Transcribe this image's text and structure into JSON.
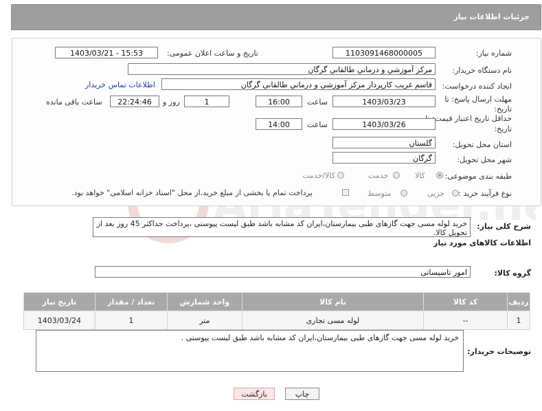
{
  "header": {
    "title": "جزئیات اطلاعات نیاز"
  },
  "form": {
    "need_number": {
      "label": "شماره نیاز:",
      "value": "1103091468000005"
    },
    "announce_datetime": {
      "label": "تاریخ و ساعت اعلان عمومی:",
      "value": "1403/03/21 - 15:53"
    },
    "buyer_org": {
      "label": "نام دستگاه خریدار:",
      "value": "مرکز آموزشي و درماني طالقاني گرگان"
    },
    "requester": {
      "label": "ایجاد کننده درخواست:",
      "value": "قاسم غريب كارپرداز مرکز آموزشي و درماني طالقاني گرگان",
      "contact_link": "اطلاعات تماس خریدار"
    },
    "reply_deadline": {
      "label_line1": "مهلت ارسال پاسخ: تا",
      "label_line2": "تاریخ:",
      "date": "1403/03/23",
      "time_label": "ساعت",
      "time": "16:00",
      "days": "1",
      "days_label": "روز و",
      "remaining": "22:24:46",
      "remaining_label": "ساعت باقی مانده"
    },
    "price_validity": {
      "label_line1": "حداقل تاریخ اعتبار قیمت: تا",
      "label_line2": "تاریخ:",
      "date": "1403/03/26",
      "time_label": "ساعت",
      "time": "14:00"
    },
    "delivery_province": {
      "label": "استان محل تحویل:",
      "value": "گلستان"
    },
    "delivery_city": {
      "label": "شهر محل تحویل:",
      "value": "گرگان"
    },
    "category": {
      "label": "طبقه بندی موضوعی:",
      "options": [
        "کالا",
        "خدمت",
        "کالا/خدمت"
      ],
      "selected": "کالا"
    },
    "purchase_process": {
      "label": "نوع فرآیند خرید :",
      "options": [
        "جزیی",
        "متوسط"
      ],
      "payment_note": "پرداخت تمام یا بخشی از مبلغ خرید،از محل \"اسناد خزانه اسلامی\" خواهد بود."
    }
  },
  "description": {
    "label": "شرح کلی نیاز:",
    "value": "خرید لوله مسی جهت گازهای طبی بیمارستان،ایران کد مشابه باشد طبق لیست پیوستی ،پرداخت حداکثر 45 روز بعد از تحویل کالا."
  },
  "goods_info": {
    "title": "اطلاعات کالاهای مورد نیاز"
  },
  "goods_group": {
    "label": "گروه کالا:",
    "value": "امور تاسیساتی"
  },
  "table": {
    "headers": [
      "ردیف",
      "کد کالا",
      "نام کالا",
      "واحد شمارش",
      "تعداد / مقدار",
      "تاریخ نیاز"
    ],
    "rows": [
      [
        "1",
        "--",
        "لوله مسی تجاری",
        "متر",
        "1",
        "1403/03/24"
      ]
    ]
  },
  "buyer_notes": {
    "label": "توضیحات خریدار:",
    "value": "خرید لوله مسی جهت گازهای طبی بیمارستان،ایران کد مشابه باشد طبق لیست پیوستی ."
  },
  "buttons": {
    "print": "چاپ",
    "back": "بازگشت"
  },
  "watermark": {
    "text": "AriaTender.neT"
  }
}
